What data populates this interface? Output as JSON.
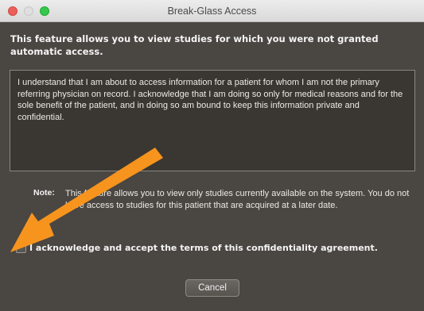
{
  "window": {
    "title": "Break-Glass Access"
  },
  "intro_text": "This feature allows you to view studies for which you were not granted automatic access.",
  "agreement_text": "I understand that I am about to access information for a patient for whom I am not the primary referring physician on record. I acknowledge that I am doing so only for medical reasons and for the sole benefit of the patient, and in doing so am bound to keep this information private and confidential.",
  "note": {
    "label": "Note:",
    "text": "This feature allows you to view only studies currently available on the system. You do not have access to studies for this patient that are acquired at a later date."
  },
  "acknowledge": {
    "label": "I acknowledge and accept the terms of this confidentiality agreement.",
    "checked": false
  },
  "buttons": {
    "cancel_label": "Cancel"
  },
  "annotation": {
    "arrow_color": "#f7941d"
  }
}
